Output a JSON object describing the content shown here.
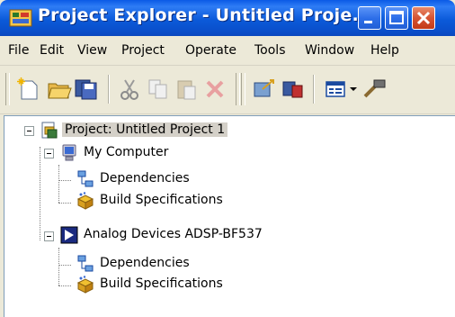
{
  "window": {
    "title": "Project Explorer - Untitled Proje..."
  },
  "menubar": {
    "items": [
      {
        "label": "File"
      },
      {
        "label": "Edit"
      },
      {
        "label": "View"
      },
      {
        "label": "Project"
      },
      {
        "label": "Operate"
      },
      {
        "label": "Tools"
      },
      {
        "label": "Window"
      },
      {
        "label": "Help"
      }
    ]
  },
  "toolbar": {
    "icons": [
      "new-icon",
      "open-icon",
      "save-all-icon",
      "cut-icon",
      "copy-icon",
      "paste-icon",
      "delete-icon",
      "build-icon",
      "deploy-icon",
      "view-icon",
      "tools-icon"
    ]
  },
  "tree": {
    "project": {
      "label": "Project: Untitled Project 1"
    },
    "my_computer": {
      "label": "My Computer",
      "dependencies": "Dependencies",
      "build_specs": "Build Specifications"
    },
    "target": {
      "label": "Analog Devices ADSP-BF537",
      "dependencies": "Dependencies",
      "build_specs": "Build Specifications"
    }
  },
  "colors": {
    "titlebar": "#0a5ae6",
    "close_button": "#d65433",
    "selection": "#d4d0c8"
  }
}
